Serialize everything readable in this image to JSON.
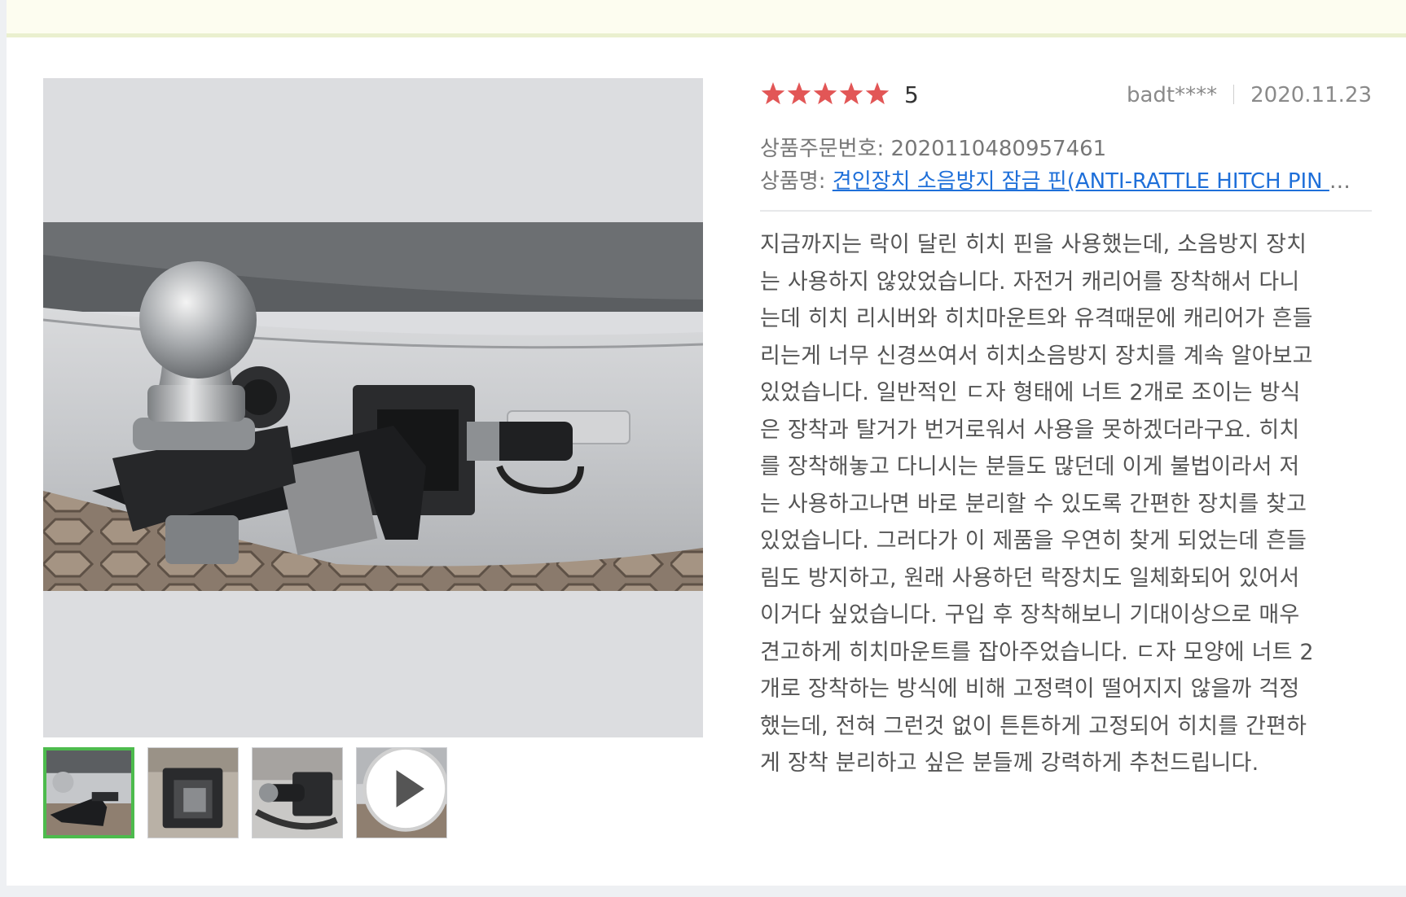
{
  "review": {
    "rating_value": "5",
    "stars_filled": 5,
    "star_color": "#e25656",
    "user": "badt****",
    "date": "2020.11.23",
    "order_label": "상품주문번호:",
    "order_number": "2020110480957461",
    "product_label": "상품명:",
    "product_name": "견인장치 소음방지 잠금 핀(ANTI-RATTLE HITCH PIN ",
    "product_ellipsis": "…",
    "body_lines": [
      "지금까지는 락이 달린 히치 핀을 사용했는데, 소음방지 장치",
      "는 사용하지 않았었습니다. 자전거 캐리어를 장착해서 다니",
      "는데 히치 리시버와 히치마운트와 유격때문에 캐리어가 흔들",
      "리는게 너무 신경쓰여서 히치소음방지 장치를 계속 알아보고",
      "있었습니다. 일반적인 ㄷ자 형태에 너트 2개로 조이는 방식",
      "은 장착과 탈거가 번거로워서 사용을 못하겠더라구요. 히치",
      "를 장착해놓고 다니시는 분들도 많던데 이게 불법이라서 저",
      "는 사용하고나면 바로 분리할 수 있도록 간편한 장치를 찾고",
      "있었습니다. 그러다가 이 제품을 우연히 찾게 되었는데 흔들",
      "림도 방지하고, 원래 사용하던 락장치도 일체화되어 있어서",
      "이거다 싶었습니다. 구입 후 장착해보니 기대이상으로 매우",
      "견고하게 히치마운트를 잡아주었습니다. ㄷ자 모양에 너트 2",
      "개로 장착하는 방식에 비해 고정력이 떨어지지 않을까 걱정",
      "했는데, 전혀 그런것 없이 튼튼하게 고정되어 히치를 간편하",
      "게 장착 분리하고 싶은 분들께 강력하게 추천드립니다."
    ]
  },
  "gallery": {
    "thumbnails": [
      {
        "kind": "photo",
        "selected": true
      },
      {
        "kind": "photo",
        "selected": false
      },
      {
        "kind": "photo",
        "selected": false
      },
      {
        "kind": "video",
        "selected": false
      }
    ],
    "selected_border_color": "#4dbb4d"
  }
}
